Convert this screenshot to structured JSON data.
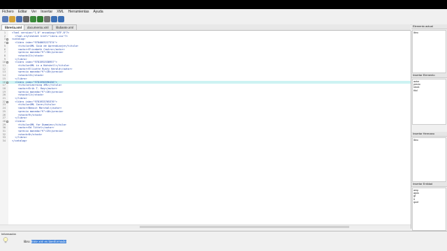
{
  "menu": [
    "Fichero",
    "Editar",
    "Ver",
    "Insertar",
    "XML",
    "Herramientas",
    "Ayuda"
  ],
  "toolbar_icons": [
    "new-file-icon",
    "open-folder-icon",
    "save-icon",
    "print-icon",
    "check-wellformed-icon",
    "validate-icon",
    "settings-icon",
    "browser-icon",
    "help-icon"
  ],
  "tabs": [
    "libreria.xml",
    "documento.xml",
    "libdiante.xml"
  ],
  "editor": {
    "highlight_line": 16,
    "lines": [
      {
        "n": "1",
        "code": "<?xml version=\"1.0\" encoding=\"UTF-8\"?>"
      },
      {
        "n": "2",
        "code": "  <?xml-stylesheet href=\"libro.css\"?>"
      },
      {
        "n": "3",
        "code": "<catalog>"
      },
      {
        "n": "4",
        "code": "  <libro isbn=\"9784003227374\">"
      },
      {
        "n": "5",
        "code": "    <titulo>XML Guía de Aprendizaje</titulo>"
      },
      {
        "n": "6",
        "code": "    <autor>Elizabeth Castro</autor>"
      },
      {
        "n": "7",
        "code": "    <precio moneda=\"€\">30</precio>"
      },
      {
        "n": "8",
        "code": "    <stock>21</stock>"
      },
      {
        "n": "9",
        "code": "  </libro>"
      },
      {
        "n": "10",
        "code": "  <libro isbn=\"9781592538957\">"
      },
      {
        "n": "11",
        "code": "    <titulo>XML in a Nutshell</titulo>"
      },
      {
        "n": "12",
        "code": "    <autor>Elliotte Rusty Harold</autor>"
      },
      {
        "n": "13",
        "code": "    <precio moneda=\"€\">28</precio>"
      },
      {
        "n": "14",
        "code": "    <stock>15</stock>"
      },
      {
        "n": "15",
        "code": "  </libro>"
      },
      {
        "n": "16",
        "code": "  <libro isbn=\"9781590596456\">"
      },
      {
        "n": "17",
        "code": "    <titulo>Learning XML</titulo>"
      },
      {
        "n": "18",
        "code": "    <autor>Erik T. Ray</autor>"
      },
      {
        "n": "19",
        "code": "    <precio moneda=\"€\">26</precio>"
      },
      {
        "n": "20",
        "code": "    <stock>11</stock>"
      },
      {
        "n": "21",
        "code": "  </libro>"
      },
      {
        "n": "22",
        "code": "  <libro isbn=\"9781933765376\">"
      },
      {
        "n": "23",
        "code": "    <titulo>XML Core</titulo>"
      },
      {
        "n": "24",
        "code": "    <autor>Benoit Marchal</autor>"
      },
      {
        "n": "25",
        "code": "    <precio moneda=\"€\">40</precio>"
      },
      {
        "n": "26",
        "code": "    <stock>9</stock>"
      },
      {
        "n": "27",
        "code": "  </libro>"
      },
      {
        "n": "28",
        "code": "  <libro>"
      },
      {
        "n": "29",
        "code": "    <titulo>XML for Dummies</titulo>"
      },
      {
        "n": "30",
        "code": "    <autor>Ed Tittel</autor>"
      },
      {
        "n": "31",
        "code": "    <precio moneda=\"€\">25</precio>"
      },
      {
        "n": "32",
        "code": "    <stock>8</stock>"
      },
      {
        "n": "33",
        "code": "  </libro>"
      },
      {
        "n": "34",
        "code": "</catalog>"
      }
    ]
  },
  "panels": {
    "current": {
      "title": "Elemento actual",
      "items": [
        "libro"
      ]
    },
    "insert_element": {
      "title": "Insertar Elemento",
      "items": [
        "autor",
        "precio",
        "stock",
        "titul"
      ]
    },
    "insert_sibling": {
      "title": "Insertar Hermano",
      "items": [
        "libro"
      ]
    },
    "insert_entity": {
      "title": "Insertar Entidad",
      "items": [
        "amp",
        "apos",
        "gt",
        "lt",
        "quot"
      ]
    }
  },
  "info": {
    "title": "Información",
    "prefix": "libro: ",
    "message": "Este xml es bienformado"
  }
}
